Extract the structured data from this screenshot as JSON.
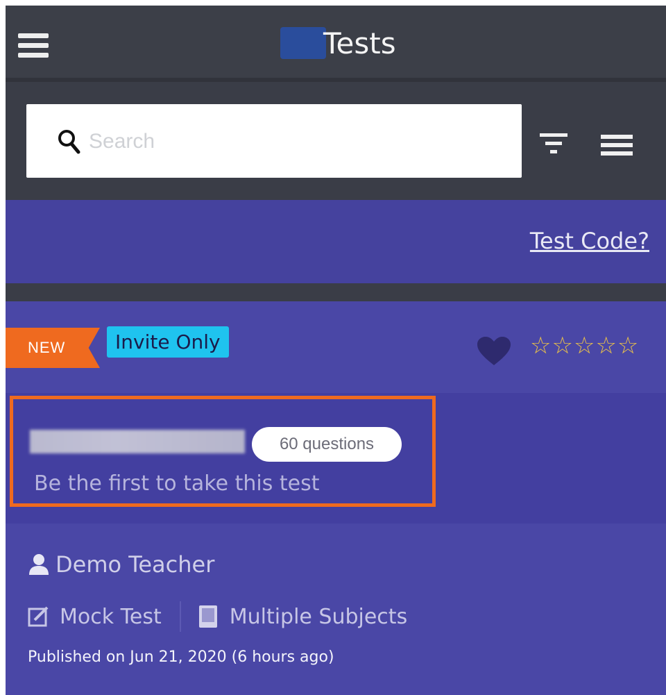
{
  "app_bar": {
    "title": "Tests",
    "menu_icon": "hamburger-menu-icon",
    "logo_icon": "app-logo-icon"
  },
  "search": {
    "placeholder": "Search",
    "value": "",
    "search_icon": "search-icon",
    "filter_icon": "filter-icon",
    "list_icon": "list-view-icon"
  },
  "test_code": {
    "label": "Test Code?"
  },
  "card": {
    "ribbon": "NEW",
    "badge": "Invite Only",
    "favorite_icon": "heart-icon",
    "rating_stars": "☆☆☆☆☆",
    "rating_value": 0,
    "rating_max": 5,
    "test_name_redacted": true,
    "questions": "60 questions",
    "subtitle": "Be the first to take this test",
    "author": "Demo Teacher",
    "type": "Mock Test",
    "subjects": "Multiple Subjects",
    "published": "Published on Jun 21, 2020 (6 hours ago)"
  },
  "colors": {
    "app_bar": "#3c3f48",
    "band": "#45429e",
    "card": "#4a47a6",
    "ribbon": "#ef6a1f",
    "badge": "#1fc3ef",
    "highlight": "#ef6a1f",
    "stars": "#e9c04a"
  }
}
